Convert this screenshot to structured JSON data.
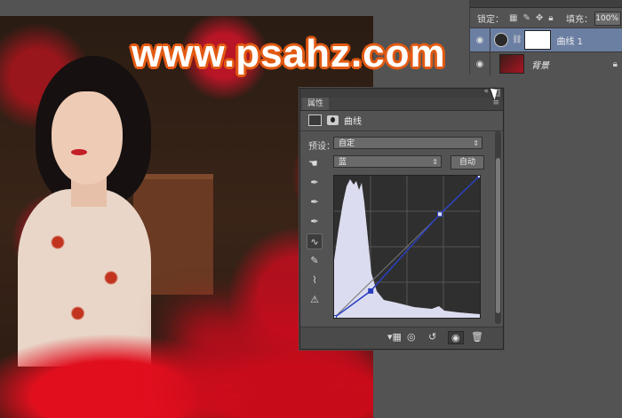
{
  "watermark": "www.psahz.com",
  "layers": {
    "lock_label": "锁定：",
    "fill_label": "填充：",
    "fill_value": "100%",
    "rows": [
      {
        "name": "曲线 1",
        "selected": true
      },
      {
        "name": "背景",
        "selected": false
      }
    ]
  },
  "properties": {
    "panel_tab": "属性",
    "menu_icon": "≡",
    "header_title": "曲线",
    "preset_label": "预设：",
    "preset_value": "自定",
    "channel_value": "蓝",
    "auto_button": "自动",
    "curve_points_note": "",
    "curve": {
      "input_range": [
        0,
        255
      ],
      "points": [
        [
          0,
          0
        ],
        [
          64,
          48
        ],
        [
          185,
          186
        ],
        [
          255,
          255
        ]
      ]
    },
    "tools": [
      "target-adjust-icon",
      "sample-black-icon",
      "sample-gray-icon",
      "sample-white-icon",
      "curve-edit-icon",
      "pencil-icon",
      "smooth-icon",
      "clipping-warning-icon"
    ],
    "bottom_icons": [
      "clip-to-layer-icon",
      "view-previous-icon",
      "reset-icon",
      "visibility-icon",
      "delete-icon"
    ]
  },
  "colors": {
    "watermark_outline": "#e25a12",
    "selected_layer": "#6b7fa3",
    "histogram": "#dcdcf0",
    "curve": "#2a3fbf"
  }
}
